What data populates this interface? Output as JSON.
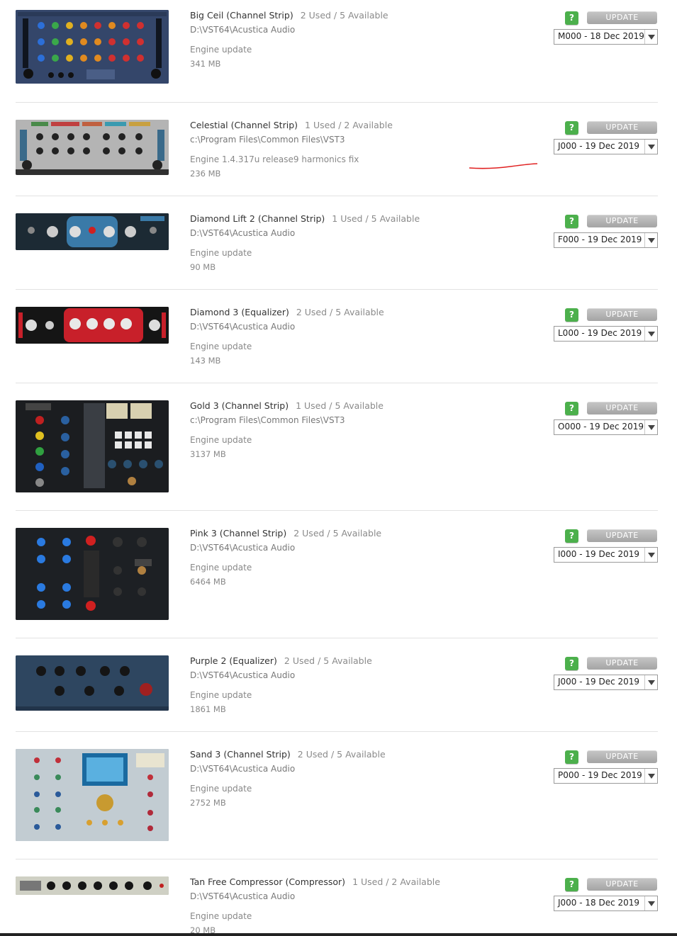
{
  "plugins": [
    {
      "name": "Big Ceil (Channel Strip)",
      "usage": "2 Used / 5 Available",
      "path": "D:\\VST64\\Acustica Audio",
      "engine": "Engine update",
      "size": "341 MB",
      "help": "?",
      "update_label": "UPDATE",
      "version": "M000 - 18 Dec 2019",
      "thumb_color": "#34466a"
    },
    {
      "name": "Celestial (Channel Strip)",
      "usage": "1 Used / 2 Available",
      "path": "c:\\Program Files\\Common Files\\VST3",
      "engine": "Engine 1.4.317u release9 harmonics fix",
      "size": "236 MB",
      "help": "?",
      "update_label": "UPDATE",
      "version": "J000 - 19 Dec 2019",
      "thumb_color": "#b8b8b8"
    },
    {
      "name": "Diamond Lift 2 (Channel Strip)",
      "usage": "1 Used / 5 Available",
      "path": "D:\\VST64\\Acustica Audio",
      "engine": "Engine update",
      "size": "90 MB",
      "help": "?",
      "update_label": "UPDATE",
      "version": "F000 - 19 Dec 2019",
      "thumb_color": "#1c2a34"
    },
    {
      "name": "Diamond 3 (Equalizer)",
      "usage": "2 Used / 5 Available",
      "path": "D:\\VST64\\Acustica Audio",
      "engine": "Engine update",
      "size": "143 MB",
      "help": "?",
      "update_label": "UPDATE",
      "version": "L000 - 19 Dec 2019",
      "thumb_color": "#151515"
    },
    {
      "name": "Gold 3 (Channel Strip)",
      "usage": "1 Used / 5 Available",
      "path": "c:\\Program Files\\Common Files\\VST3",
      "engine": "Engine update",
      "size": "3137 MB",
      "help": "?",
      "update_label": "UPDATE",
      "version": "O000 - 19 Dec 2019",
      "thumb_color": "#1b1d20"
    },
    {
      "name": "Pink 3 (Channel Strip)",
      "usage": "2 Used / 5 Available",
      "path": "D:\\VST64\\Acustica Audio",
      "engine": "Engine update",
      "size": "6464 MB",
      "help": "?",
      "update_label": "UPDATE",
      "version": "I000 - 19 Dec 2019",
      "thumb_color": "#1d2024"
    },
    {
      "name": "Purple 2 (Equalizer)",
      "usage": "2 Used / 5 Available",
      "path": "D:\\VST64\\Acustica Audio",
      "engine": "Engine update",
      "size": "1861 MB",
      "help": "?",
      "update_label": "UPDATE",
      "version": "J000 - 19 Dec 2019",
      "thumb_color": "#2e4660"
    },
    {
      "name": "Sand 3 (Channel Strip)",
      "usage": "2 Used / 5 Available",
      "path": "D:\\VST64\\Acustica Audio",
      "engine": "Engine update",
      "size": "2752 MB",
      "help": "?",
      "update_label": "UPDATE",
      "version": "P000 - 19 Dec 2019",
      "thumb_color": "#c2ccd2"
    },
    {
      "name": "Tan Free Compressor (Compressor)",
      "usage": "1 Used / 2 Available",
      "path": "D:\\VST64\\Acustica Audio",
      "engine": "Engine update",
      "size": "20 MB",
      "help": "?",
      "update_label": "UPDATE",
      "version": "J000 - 18 Dec 2019",
      "thumb_color": "#cfd0c4"
    }
  ],
  "colors": {
    "help_button": "#4cb04c",
    "update_button": "#b0b0b0",
    "annotation": "#e02020"
  }
}
